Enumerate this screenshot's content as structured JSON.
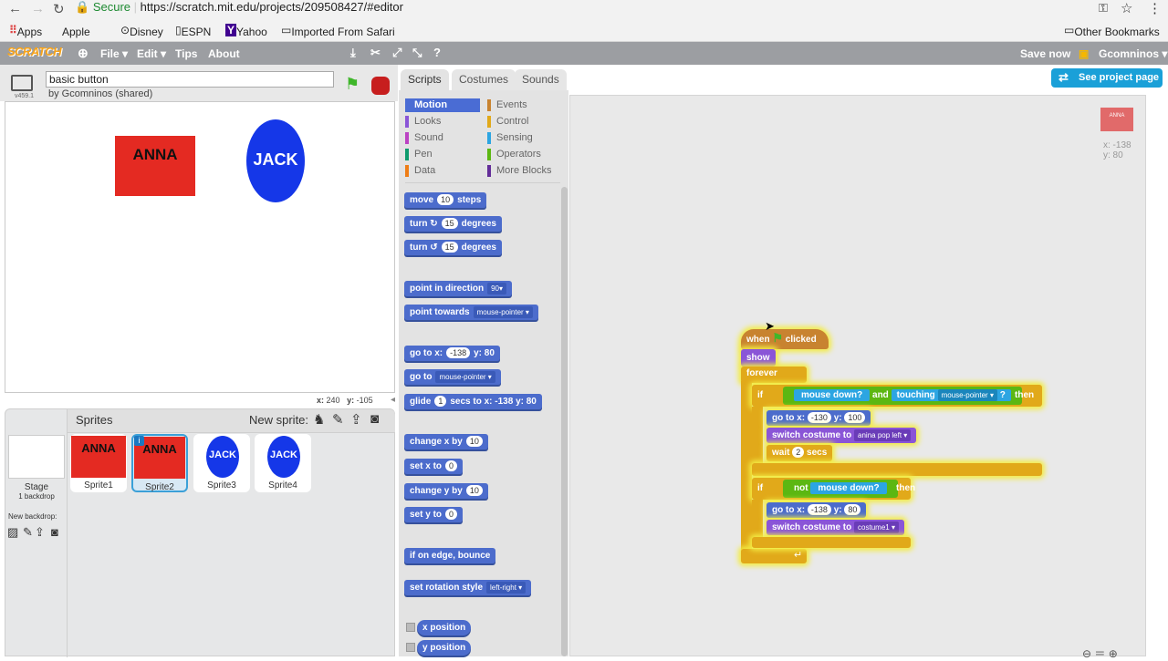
{
  "browser": {
    "secure_label": "Secure",
    "url": "https://scratch.mit.edu/projects/209508427/#editor",
    "bookmarks": [
      "Apps",
      "Apple",
      "Disney",
      "ESPN",
      "Yahoo",
      "Imported From Safari"
    ],
    "other_bookmarks": "Other Bookmarks"
  },
  "menubar": {
    "logo": "SCRATCH",
    "items": [
      "File ▾",
      "Edit ▾",
      "Tips",
      "About"
    ],
    "save_now": "Save now",
    "user": "Gcomninos ▾",
    "see_project": "See project page"
  },
  "project": {
    "title": "basic button",
    "byline": "by Gcomninos (shared)",
    "version": "v459.1"
  },
  "stage": {
    "sprites": [
      {
        "name": "ANNA",
        "kind": "rectangle",
        "color": "#e42a22"
      },
      {
        "name": "JACK",
        "kind": "ellipse",
        "color": "#1537e8"
      }
    ],
    "coords": {
      "x_label": "x:",
      "x": "240",
      "y_label": "y:",
      "y": "-105"
    }
  },
  "sprite_pane": {
    "header": "Sprites",
    "new_sprite": "New sprite:",
    "stage_label": "Stage",
    "stage_sub": "1 backdrop",
    "new_backdrop": "New backdrop:",
    "sprites": [
      {
        "label": "Sprite1",
        "text": "ANNA"
      },
      {
        "label": "Sprite2",
        "text": "ANNA",
        "selected": true
      },
      {
        "label": "Sprite3",
        "text": "JACK"
      },
      {
        "label": "Sprite4",
        "text": "JACK"
      }
    ]
  },
  "tabs": [
    "Scripts",
    "Costumes",
    "Sounds"
  ],
  "categories": [
    {
      "label": "Motion",
      "color": "#4a6cd4",
      "active": true
    },
    {
      "label": "Looks",
      "color": "#8a55d7"
    },
    {
      "label": "Sound",
      "color": "#bb42c3"
    },
    {
      "label": "Pen",
      "color": "#0e9a6c"
    },
    {
      "label": "Data",
      "color": "#ee7d16"
    },
    {
      "label": "Events",
      "color": "#c88330"
    },
    {
      "label": "Control",
      "color": "#e1a91a"
    },
    {
      "label": "Sensing",
      "color": "#2ca5e2"
    },
    {
      "label": "Operators",
      "color": "#5cb712"
    },
    {
      "label": "More Blocks",
      "color": "#632d99"
    }
  ],
  "palette_blocks": [
    {
      "text": "move",
      "a": "10",
      "b": "steps"
    },
    {
      "text": "turn ↻",
      "a": "15",
      "b": "degrees"
    },
    {
      "text": "turn ↺",
      "a": "15",
      "b": "degrees"
    },
    {
      "text": "point in direction",
      "a": "90▾",
      "b": ""
    },
    {
      "text": "point towards",
      "a": "mouse-pointer ▾",
      "b": ""
    },
    {
      "text": "go to x:",
      "a": "-138",
      "b": "y: 80"
    },
    {
      "text": "go to",
      "a": "mouse-pointer ▾",
      "b": ""
    },
    {
      "text": "glide",
      "a": "1",
      "b": "secs to x: -138 y: 80"
    },
    {
      "text": "change x by",
      "a": "10",
      "b": ""
    },
    {
      "text": "set x to",
      "a": "0",
      "b": ""
    },
    {
      "text": "change y by",
      "a": "10",
      "b": ""
    },
    {
      "text": "set y to",
      "a": "0",
      "b": ""
    },
    {
      "text": "if on edge, bounce",
      "a": "",
      "b": ""
    },
    {
      "text": "set rotation style",
      "a": "left-right ▾",
      "b": ""
    },
    {
      "text": "x position",
      "a": "",
      "b": ""
    },
    {
      "text": "y position",
      "a": "",
      "b": ""
    }
  ],
  "script": {
    "hat": "when",
    "hat2": "clicked",
    "show": "show",
    "forever": "forever",
    "if1": {
      "if": "if",
      "cond_a": "mouse down?",
      "and": "and",
      "touching": "touching",
      "touch_target": "mouse-pointer ▾",
      "q": "?",
      "then": "then"
    },
    "goto1": {
      "label": "go to x:",
      "x": "-130",
      "y_label": "y:",
      "y": "100"
    },
    "switch1": {
      "label": "switch costume to",
      "costume": "anina pop left ▾"
    },
    "wait": {
      "label": "wait",
      "secs": "2",
      "unit": "secs"
    },
    "if2": {
      "if": "if",
      "not": "not",
      "cond": "mouse down?",
      "then": "then"
    },
    "goto2": {
      "label": "go to x:",
      "x": "-138",
      "y_label": "y:",
      "y": "80"
    },
    "switch2": {
      "label": "switch costume to",
      "costume": "costume1 ▾"
    }
  },
  "mini_sprite": {
    "text": "ANNA",
    "x": "x: -138",
    "y": "y: 80"
  }
}
